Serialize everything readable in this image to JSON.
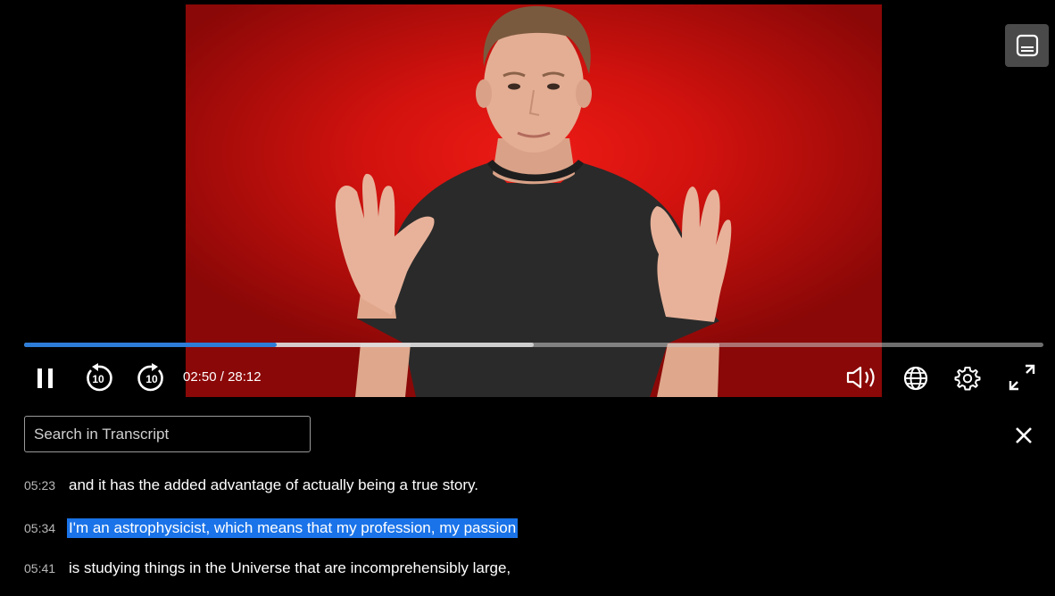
{
  "player": {
    "progress_fraction": 0.248,
    "buffered_fraction": 0.5,
    "current_time": "02:50",
    "duration": "28:12",
    "time_separator": " / ",
    "colors": {
      "progress_played": "#2d7dd8",
      "highlight": "#1a73e8",
      "video_backdrop": "#d2120e"
    },
    "controls": {
      "pause": "pause-icon",
      "rewind_10": "rewind-10-icon",
      "rewind_label": "10",
      "forward_10": "forward-10-icon",
      "forward_label": "10",
      "volume": "volume-icon",
      "language": "globe-icon",
      "settings": "gear-icon",
      "fullscreen": "fullscreen-icon",
      "captions": "captions-icon"
    }
  },
  "transcript": {
    "search_placeholder": "Search in Transcript",
    "search_value": "",
    "close_icon": "close-icon",
    "lines": [
      {
        "time": "05:23",
        "text": "and it has the added advantage of actually being a true story.",
        "active": false
      },
      {
        "time": "05:34",
        "text": "I'm an astrophysicist, which means that my profession, my passion",
        "active": true
      },
      {
        "time": "05:41",
        "text": "is studying things in the Universe that are incomprehensibly large,",
        "active": false
      }
    ]
  }
}
